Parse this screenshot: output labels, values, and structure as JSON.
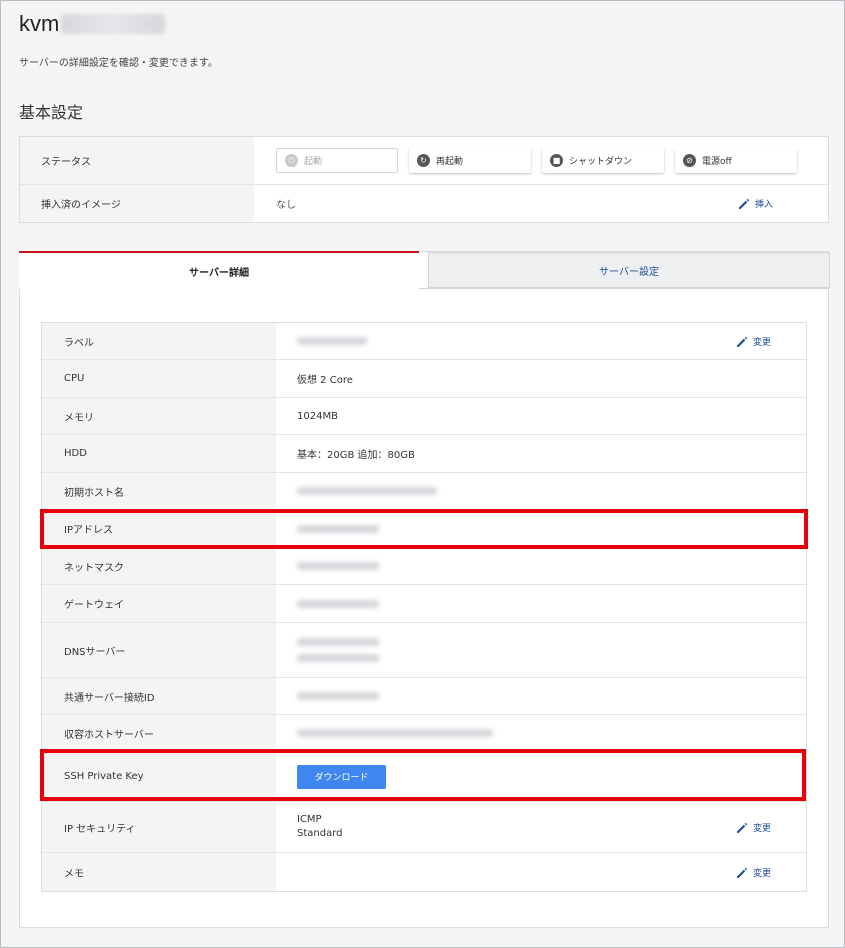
{
  "header": {
    "title_prefix": "kvm",
    "description": "サーバーの詳細設定を確認・変更できます。"
  },
  "basic": {
    "section_title": "基本設定",
    "status_label": "ステータス",
    "buttons": {
      "start": "起動",
      "restart": "再起動",
      "shutdown": "シャットダウン",
      "power_off": "電源off"
    },
    "image_label": "挿入済のイメージ",
    "image_value": "なし",
    "insert_label": "挿入"
  },
  "tabs": {
    "detail": "サーバー詳細",
    "settings": "サーバー設定"
  },
  "details": {
    "label_row": {
      "label": "ラベル",
      "edit": "変更"
    },
    "cpu": {
      "label": "CPU",
      "value": "仮想 2 Core"
    },
    "memory": {
      "label": "メモリ",
      "value": "1024MB"
    },
    "hdd": {
      "label": "HDD",
      "value": "基本：20GB 追加：80GB"
    },
    "hostname": {
      "label": "初期ホスト名"
    },
    "ip": {
      "label": "IPアドレス"
    },
    "netmask": {
      "label": "ネットマスク"
    },
    "gateway": {
      "label": "ゲートウェイ"
    },
    "dns": {
      "label": "DNSサーバー"
    },
    "shared_id": {
      "label": "共通サーバー接続ID"
    },
    "host_server": {
      "label": "収容ホストサーバー"
    },
    "ssh": {
      "label": "SSH Private Key",
      "button": "ダウンロード"
    },
    "ip_security": {
      "label": "IP セキュリティ",
      "value_1": "ICMP",
      "value_2": "Standard",
      "edit": "変更"
    },
    "memo": {
      "label": "メモ",
      "edit": "変更"
    }
  },
  "colors": {
    "highlight": "#e8000b",
    "accent_tab": "#c8161d",
    "link": "#1f4e9b",
    "download_button": "#3f86f0"
  }
}
